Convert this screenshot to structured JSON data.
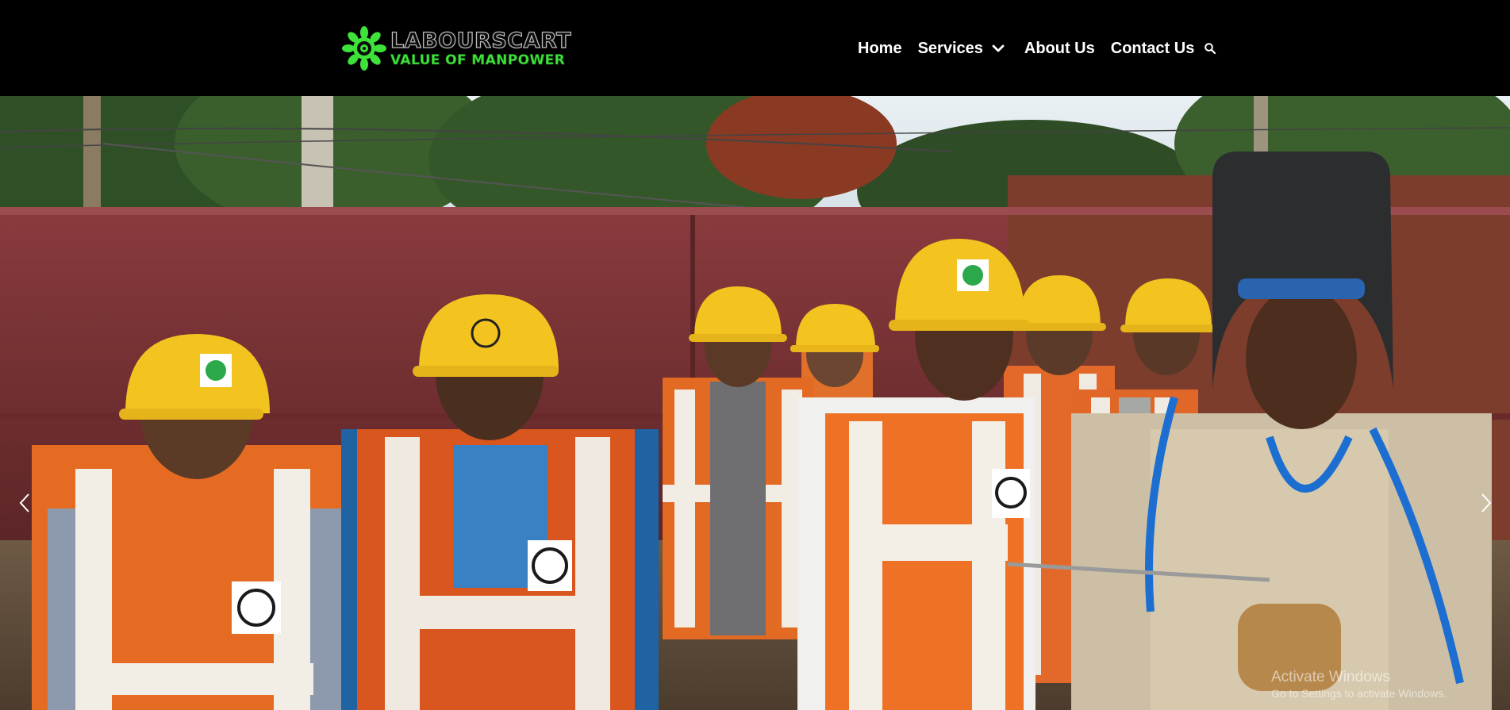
{
  "header": {
    "logo": {
      "name": "LABOURSCART",
      "tagline": "VALUE OF MANPOWER",
      "icon": "gear-flower-logo-icon"
    },
    "nav": {
      "home": "Home",
      "services": "Services",
      "about": "About Us",
      "contact": "Contact Us"
    },
    "icons": {
      "services_dropdown": "chevron-down-icon",
      "search": "search-icon"
    }
  },
  "hero": {
    "image": "construction-workers-photo",
    "prev_icon": "chevron-left-icon",
    "next_icon": "chevron-right-icon"
  },
  "watermark": {
    "title": "Activate Windows",
    "subtitle": "Go to Settings to activate Windows."
  },
  "colors": {
    "header_bg": "#000000",
    "nav_text": "#ffffff",
    "logo_green": "#3ee23a",
    "helmet_yellow": "#f3c320",
    "vest_orange": "#ef6b1f",
    "wall_red": "#7b3235"
  }
}
